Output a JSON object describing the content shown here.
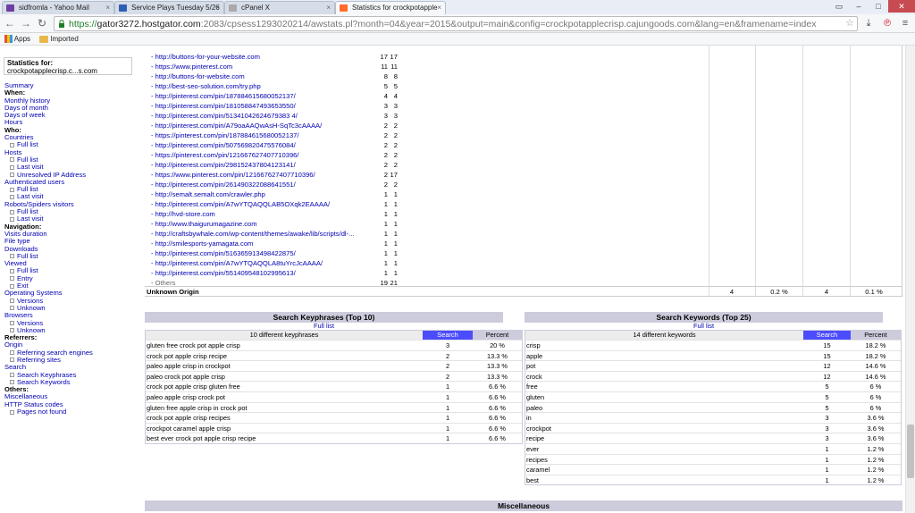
{
  "browser": {
    "tabs": [
      {
        "title": "sidfromla - Yahoo Mail",
        "icon": "mail-icon",
        "color": "#6b3fa0"
      },
      {
        "title": "Service Plays Tuesday 5/26",
        "icon": "page-icon",
        "color": "#2d5fb5"
      },
      {
        "title": "cPanel X",
        "icon": "page-icon",
        "color": "#888888"
      },
      {
        "title": "Statistics for crockpotapple",
        "icon": "cpanel-icon",
        "color": "#ff6c2c"
      }
    ],
    "url_scheme": "https://",
    "url_host": "gator3272.hostgator.com",
    "url_rest": ":2083/cpsess1293020214/awstats.pl?month=04&year=2015&output=main&config=crockpotapplecrisp.cajungoods.com&lang=en&framename=index",
    "bookmarks": {
      "apps": "Apps",
      "imported": "Imported"
    }
  },
  "sidebar": {
    "stats_label": "Statistics for:",
    "site": "crockpotapplecrisp.c...s.com",
    "items": [
      {
        "text": "Summary",
        "type": "link"
      },
      {
        "text": "When:",
        "type": "head"
      },
      {
        "text": "Monthly history",
        "type": "link"
      },
      {
        "text": "Days of month",
        "type": "link"
      },
      {
        "text": "Days of week",
        "type": "link"
      },
      {
        "text": "Hours",
        "type": "link"
      },
      {
        "text": "Who:",
        "type": "head"
      },
      {
        "text": "Countries",
        "type": "link"
      },
      {
        "text": "Full list",
        "type": "sub"
      },
      {
        "text": "Hosts",
        "type": "link"
      },
      {
        "text": "Full list",
        "type": "sub"
      },
      {
        "text": "Last visit",
        "type": "sub"
      },
      {
        "text": "Unresolved IP Address",
        "type": "sub"
      },
      {
        "text": "Authenticated users",
        "type": "link"
      },
      {
        "text": "Full list",
        "type": "sub"
      },
      {
        "text": "Last visit",
        "type": "sub"
      },
      {
        "text": "Robots/Spiders visitors",
        "type": "link"
      },
      {
        "text": "Full list",
        "type": "sub"
      },
      {
        "text": "Last visit",
        "type": "sub"
      },
      {
        "text": "Navigation:",
        "type": "head"
      },
      {
        "text": "Visits duration",
        "type": "link"
      },
      {
        "text": "File type",
        "type": "link"
      },
      {
        "text": "Downloads",
        "type": "link"
      },
      {
        "text": "Full list",
        "type": "sub"
      },
      {
        "text": "Viewed",
        "type": "link"
      },
      {
        "text": "Full list",
        "type": "sub"
      },
      {
        "text": "Entry",
        "type": "sub"
      },
      {
        "text": "Exit",
        "type": "sub"
      },
      {
        "text": "Operating Systems",
        "type": "link"
      },
      {
        "text": "Versions",
        "type": "sub"
      },
      {
        "text": "Unknown",
        "type": "sub"
      },
      {
        "text": "Browsers",
        "type": "link"
      },
      {
        "text": "Versions",
        "type": "sub"
      },
      {
        "text": "Unknown",
        "type": "sub"
      },
      {
        "text": "Referrers:",
        "type": "head"
      },
      {
        "text": "Origin",
        "type": "link"
      },
      {
        "text": "Referring search engines",
        "type": "sub"
      },
      {
        "text": "Referring sites",
        "type": "sub"
      },
      {
        "text": "Search",
        "type": "link"
      },
      {
        "text": "Search Keyphrases",
        "type": "sub"
      },
      {
        "text": "Search Keywords",
        "type": "sub"
      },
      {
        "text": "Others:",
        "type": "head"
      },
      {
        "text": "Miscellaneous",
        "type": "link"
      },
      {
        "text": "HTTP Status codes",
        "type": "link"
      },
      {
        "text": "Pages not found",
        "type": "sub"
      }
    ]
  },
  "referrers": {
    "rows": [
      {
        "url": "- http://buttons-for-your-website.com",
        "a": "17",
        "b": "17"
      },
      {
        "url": "- https://www.pinterest.com",
        "a": "11",
        "b": "11"
      },
      {
        "url": "- http://buttons-for-website.com",
        "a": "8",
        "b": "8"
      },
      {
        "url": "- http://best-seo-solution.com/try.php",
        "a": "5",
        "b": "5"
      },
      {
        "url": "- http://pinterest.com/pin/187884615680052137/",
        "a": "4",
        "b": "4"
      },
      {
        "url": "- http://pinterest.com/pin/181058847493653550/",
        "a": "3",
        "b": "3"
      },
      {
        "url": "- http://pinterest.com/pin/51341042624679383 4/",
        "a": "3",
        "b": "3"
      },
      {
        "url": "- http://pinterest.com/pin/A79oaAAQwAsH-SqTc3cAAAA/",
        "a": "2",
        "b": "2"
      },
      {
        "url": "- https://pinterest.com/pin/187884615680052137/",
        "a": "2",
        "b": "2"
      },
      {
        "url": "- http://pinterest.com/pin/507569820475576084/",
        "a": "2",
        "b": "2"
      },
      {
        "url": "- https://pinterest.com/pin/121667627407710396/",
        "a": "2",
        "b": "2"
      },
      {
        "url": "- http://pinterest.com/pin/298152437804123141/",
        "a": "2",
        "b": "2"
      },
      {
        "url": "- https://www.pinterest.com/pin/121667627407710396/",
        "a": "2",
        "b": "17"
      },
      {
        "url": "- http://pinterest.com/pin/261490322088641551/",
        "a": "2",
        "b": "2"
      },
      {
        "url": "- http://semalt.semalt.com/crawler.php",
        "a": "1",
        "b": "1"
      },
      {
        "url": "- http://pinterest.com/pin/A7wYTQAQQLAB5OXqk2EAAAA/",
        "a": "1",
        "b": "1"
      },
      {
        "url": "- http://hvd-store.com",
        "a": "1",
        "b": "1"
      },
      {
        "url": "- http://www.thaigurumagazine.com",
        "a": "1",
        "b": "1"
      },
      {
        "url": "- http://craftsbywhale.com/wp-content/themes/awake/lib/scripts/dl-...",
        "a": "1",
        "b": "1"
      },
      {
        "url": "- http://smilesports-yamagata.com",
        "a": "1",
        "b": "1"
      },
      {
        "url": "- http://pinterest.com/pin/516365913498422875/",
        "a": "1",
        "b": "1"
      },
      {
        "url": "- http://pinterest.com/pin/A7wYTQAQQLA8tuYrcJcAAAA/",
        "a": "1",
        "b": "1"
      },
      {
        "url": "- http://pinterest.com/pin/551409548102995613/",
        "a": "1",
        "b": "1"
      },
      {
        "url": "- Others",
        "a": "19",
        "b": "21"
      }
    ],
    "unknown": {
      "label": "Unknown Origin",
      "pages": "4",
      "pages_pct": "0.2 %",
      "hits": "4",
      "hits_pct": "0.1 %"
    }
  },
  "keyphrases": {
    "title": "Search Keyphrases (Top 10)",
    "full_list": "Full list",
    "count_label": "10 different keyphrases",
    "col_search": "Search",
    "col_percent": "Percent",
    "rows": [
      {
        "k": "gluten free crock pot apple crisp",
        "s": "3",
        "p": "20 %"
      },
      {
        "k": "crock pot apple crisp recipe",
        "s": "2",
        "p": "13.3 %"
      },
      {
        "k": "paleo apple crisp in crockpot",
        "s": "2",
        "p": "13.3 %"
      },
      {
        "k": "paleo crock pot apple crisp",
        "s": "2",
        "p": "13.3 %"
      },
      {
        "k": "crock pot apple crisp gluten free",
        "s": "1",
        "p": "6.6 %"
      },
      {
        "k": "paleo apple crisp crock pot",
        "s": "1",
        "p": "6.6 %"
      },
      {
        "k": "gluten free apple crisp in crock pot",
        "s": "1",
        "p": "6.6 %"
      },
      {
        "k": "crock pot apple crisp recipes",
        "s": "1",
        "p": "6.6 %"
      },
      {
        "k": "crockpot caramel apple crisp",
        "s": "1",
        "p": "6.6 %"
      },
      {
        "k": "best ever crock pot apple crisp recipe",
        "s": "1",
        "p": "6.6 %"
      }
    ]
  },
  "keywords": {
    "title": "Search Keywords (Top 25)",
    "full_list": "Full list",
    "count_label": "14 different keywords",
    "col_search": "Search",
    "col_percent": "Percent",
    "rows": [
      {
        "k": "crisp",
        "s": "15",
        "p": "18.2 %"
      },
      {
        "k": "apple",
        "s": "15",
        "p": "18.2 %"
      },
      {
        "k": "pot",
        "s": "12",
        "p": "14.6 %"
      },
      {
        "k": "crock",
        "s": "12",
        "p": "14.6 %"
      },
      {
        "k": "free",
        "s": "5",
        "p": "6 %"
      },
      {
        "k": "gluten",
        "s": "5",
        "p": "6 %"
      },
      {
        "k": "paleo",
        "s": "5",
        "p": "6 %"
      },
      {
        "k": "in",
        "s": "3",
        "p": "3.6 %"
      },
      {
        "k": "crockpot",
        "s": "3",
        "p": "3.6 %"
      },
      {
        "k": "recipe",
        "s": "3",
        "p": "3.6 %"
      },
      {
        "k": "ever",
        "s": "1",
        "p": "1.2 %"
      },
      {
        "k": "recipes",
        "s": "1",
        "p": "1.2 %"
      },
      {
        "k": "caramel",
        "s": "1",
        "p": "1.2 %"
      },
      {
        "k": "best",
        "s": "1",
        "p": "1.2 %"
      }
    ]
  },
  "misc_title": "Miscellaneous",
  "colors": {
    "link": "#0000b3",
    "table_head": "#ccccdd",
    "search_head": "#4c4cff"
  }
}
